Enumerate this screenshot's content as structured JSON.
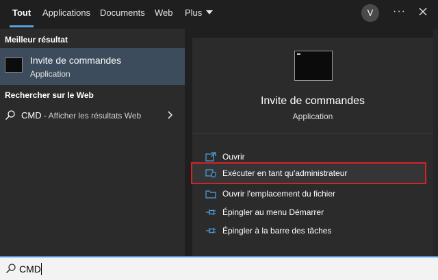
{
  "tabs": [
    {
      "label": "Tout",
      "active": true
    },
    {
      "label": "Applications"
    },
    {
      "label": "Documents"
    },
    {
      "label": "Web"
    },
    {
      "label": "Plus"
    }
  ],
  "user_initial": "V",
  "more_label": "···",
  "left": {
    "best_match_title": "Meilleur résultat",
    "best_match": {
      "title": "Invite de commandes",
      "subtitle": "Application"
    },
    "web_title": "Rechercher sur le Web",
    "web_item": {
      "query": "CMD",
      "suffix": " - Afficher les résultats Web"
    }
  },
  "right": {
    "title": "Invite de commandes",
    "subtitle": "Application",
    "actions": [
      {
        "label": "Ouvrir",
        "icon": "open-icon"
      },
      {
        "label": "Exécuter en tant qu'administrateur",
        "icon": "admin-shield-icon"
      },
      {
        "label": "Ouvrir l'emplacement du fichier",
        "icon": "folder-icon"
      },
      {
        "label": "Épingler au menu Démarrer",
        "icon": "pin-icon"
      },
      {
        "label": "Épingler à la barre des tâches",
        "icon": "pin-icon"
      }
    ]
  },
  "search": {
    "value": "CMD"
  },
  "colors": {
    "accent": "#5aa0e0",
    "selection": "#3d4c5c",
    "highlight_border": "#d4222a",
    "icon_blue": "#4aa3e8"
  }
}
